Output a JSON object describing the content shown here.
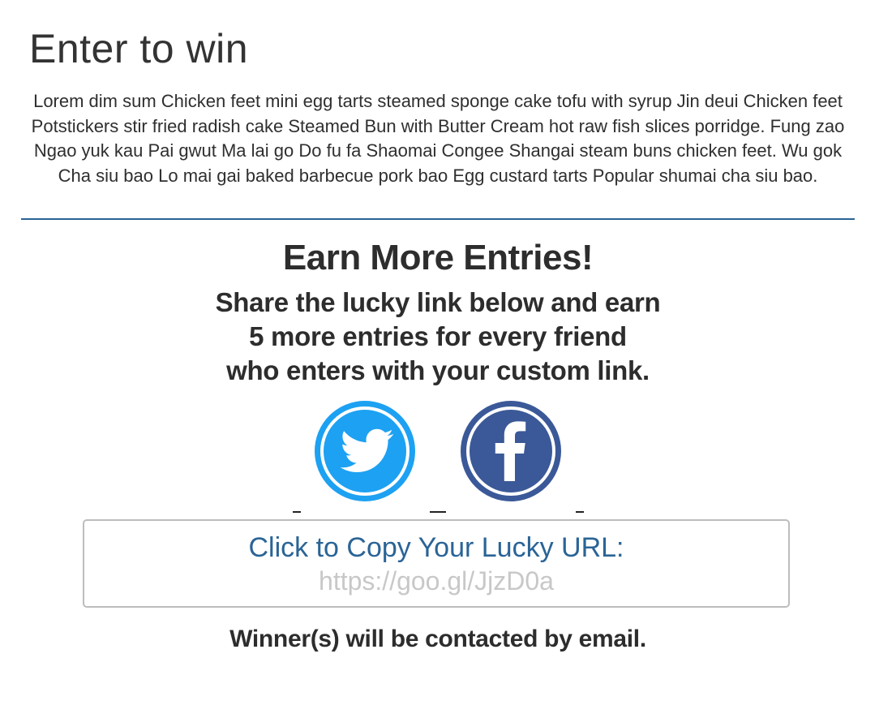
{
  "page": {
    "title": "Enter to win",
    "intro": "Lorem dim sum Chicken feet mini egg tarts steamed sponge cake tofu with syrup Jin deui Chicken feet Potstickers stir fried radish cake Steamed Bun with Butter Cream hot raw fish slices porridge. Fung zao Ngao yuk kau Pai gwut Ma lai go Do fu fa Shaomai Congee Shangai steam buns chicken feet. Wu gok Cha siu bao Lo mai gai baked barbecue pork bao Egg custard tarts Popular shumai cha siu bao."
  },
  "earn": {
    "heading": "Earn More Entries!",
    "lines": [
      "Share the lucky link below and earn",
      "5 more entries for every friend",
      "who enters with your custom link."
    ]
  },
  "social": {
    "twitter_icon": "twitter-icon",
    "facebook_icon": "facebook-icon",
    "twitter_color": "#1da1f2",
    "facebook_color": "#3b5998"
  },
  "copy": {
    "label": "Click to Copy Your Lucky URL:",
    "url": "https://goo.gl/JjzD0a"
  },
  "footer": {
    "note": "Winner(s) will be contacted by email."
  },
  "colors": {
    "accent": "#2a6496",
    "text": "#2d2d2d",
    "url_placeholder": "#c8c8c8"
  }
}
